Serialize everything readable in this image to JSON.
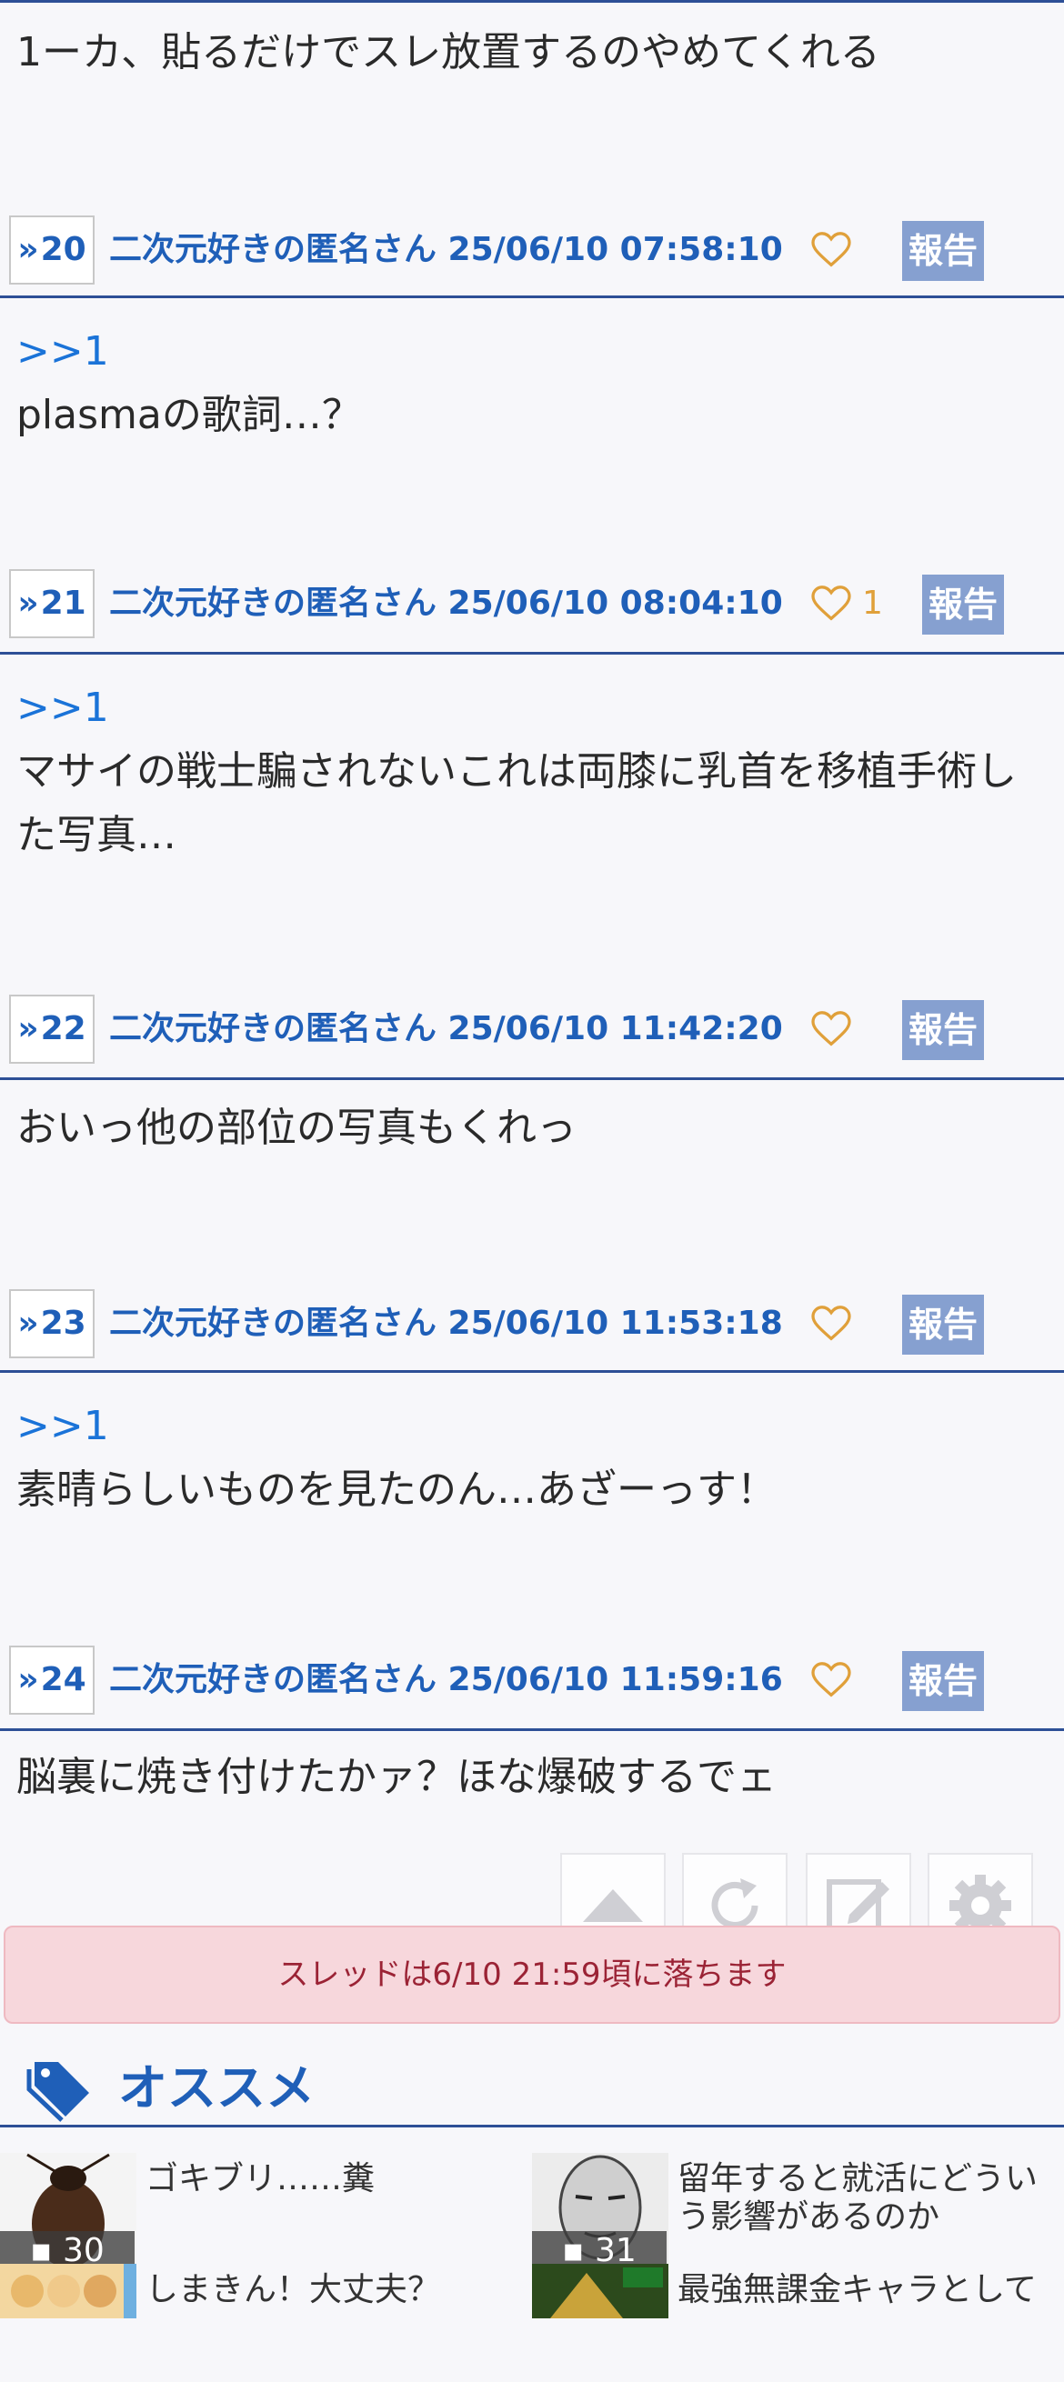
{
  "posts": [
    {
      "body": "1ーカ、貼るだけでスレ放置するのやめてくれる",
      "anchor": ""
    },
    {
      "resno": "20",
      "author_line": "二次元好きの匿名さん 25/06/10 07:58:10",
      "likes": "",
      "report": "報告",
      "anchor": ">>1",
      "body": "plasmaの歌詞…？"
    },
    {
      "resno": "21",
      "author_line": "二次元好きの匿名さん 25/06/10 08:04:10",
      "likes": "1",
      "report": "報告",
      "anchor": ">>1",
      "body": "マサイの戦士騙されないこれは両膝に乳首を移植手術した写真…"
    },
    {
      "resno": "22",
      "author_line": "二次元好きの匿名さん 25/06/10 11:42:20",
      "likes": "",
      "report": "報告",
      "anchor": "",
      "body": "おいっ他の部位の写真もくれっ"
    },
    {
      "resno": "23",
      "author_line": "二次元好きの匿名さん 25/06/10 11:53:18",
      "likes": "",
      "report": "報告",
      "anchor": ">>1",
      "body": "素晴らしいものを見たのん…あざーっす！"
    },
    {
      "resno": "24",
      "author_line": "二次元好きの匿名さん 25/06/10 11:59:16",
      "likes": "",
      "report": "報告",
      "anchor": "",
      "body": "脳裏に焼き付けたかァ？ほな爆破するでェ"
    }
  ],
  "notice": "スレッドは6/10 21:59頃に落ちます",
  "recommend": {
    "title": "オススメ",
    "items": [
      {
        "title": "ゴキブリ……糞",
        "count": "30"
      },
      {
        "title": "留年すると就活にどういう影響があるのか",
        "count": "31"
      },
      {
        "title": "しまきん！大丈夫？",
        "count": ""
      },
      {
        "title": "最強無課金キャラとして",
        "count": ""
      }
    ]
  },
  "colors": {
    "accent": "#1f5fb8",
    "anchor": "#1a73d8",
    "report_bg": "#86a0d0",
    "heart": "#e0a03a",
    "notice_bg": "#f7d7dc",
    "notice_text": "#9b2335"
  }
}
